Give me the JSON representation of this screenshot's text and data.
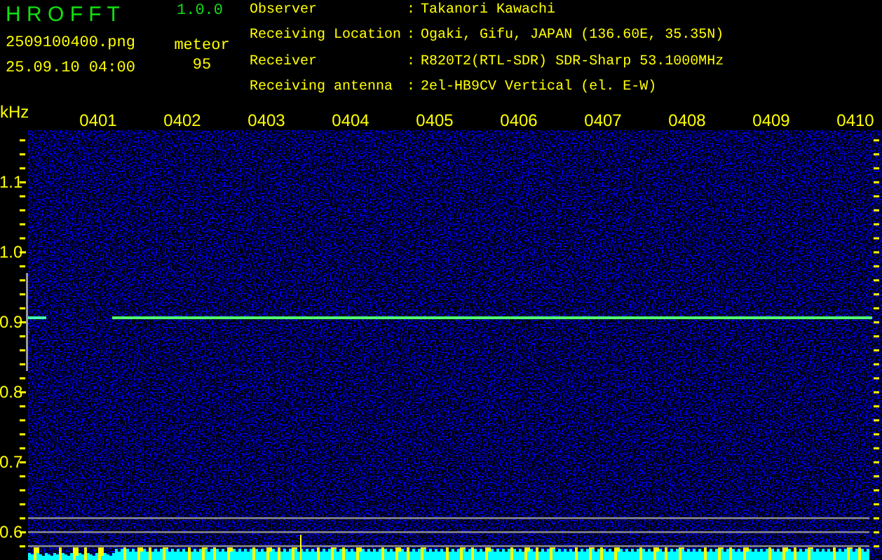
{
  "header": {
    "app_title": "H R O F F T",
    "version": "1.0.0",
    "file_name": "2509100400.png",
    "timestamp": "25.09.10 04:00",
    "count_label": "meteor",
    "count": "95"
  },
  "station_info": [
    {
      "label": "Observer",
      "separator": ":",
      "value": "Takanori Kawachi"
    },
    {
      "label": "Receiving Location",
      "separator": ":",
      "value": "Ogaki, Gifu, JAPAN (136.60E, 35.35N)"
    },
    {
      "label": "Receiver",
      "separator": ":",
      "value": "R820T2(RTL-SDR) SDR-Sharp 53.1000MHz"
    },
    {
      "label": "Receiving antenna",
      "separator": ":",
      "value": "2el-HB9CV Vertical (el. E-W)"
    }
  ],
  "plot": {
    "y_unit": "kHz",
    "y_labels": [
      "1.1",
      "1.0",
      "0.9",
      "0.8",
      "0.7",
      "0.6"
    ],
    "x_labels": [
      "0401",
      "0402",
      "0403",
      "0404",
      "0405",
      "0406",
      "0407",
      "0408",
      "0409",
      "0410"
    ]
  }
}
